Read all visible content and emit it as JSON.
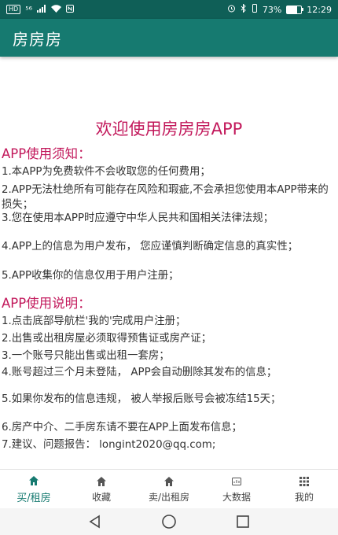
{
  "status_bar": {
    "left_badges": [
      "HD",
      "⁵⁶"
    ],
    "battery": "73%",
    "battery_level": 0.73,
    "time": "12:29"
  },
  "app_bar": {
    "title": "房房房"
  },
  "content": {
    "welcome": "欢迎使用房房房APP",
    "notice_title": "APP使用须知：",
    "notice_items": [
      "1.本APP为免费软件不会收取您的任何费用；",
      "2.APP无法杜绝所有可能存在风险和瑕疵,不会承担您使用本APP带来的损失；",
      "3.您在使用本APP时应遵守中华人民共和国相关法律法规；",
      "4.APP上的信息为用户发布， 您应谨慎判断确定信息的真实性；",
      "5.APP收集你的信息仅用于用户注册；"
    ],
    "usage_title": "APP使用说明：",
    "usage_items": [
      "1.点击底部导航栏'我的'完成用户注册；",
      "2.出售或出租房屋必须取得预售证或房产证；",
      "3.一个账号只能出售或出租一套房；",
      "4.账号超过三个月未登陆， APP会自动删除其发布的信息；",
      "5.如果你发布的信息违规， 被人举报后账号会被冻结15天；",
      "6.房产中介、二手房东请不要在APP上面发布信息；",
      "7.建议、问题报告： longint2020@qq.com;"
    ]
  },
  "bottom_nav": [
    {
      "label": "买/租房",
      "icon": "home-icon",
      "active": true
    },
    {
      "label": "收藏",
      "icon": "home-icon",
      "active": false
    },
    {
      "label": "卖/出租房",
      "icon": "home-icon",
      "active": false
    },
    {
      "label": "大数据",
      "icon": "data-icon",
      "active": false
    },
    {
      "label": "我的",
      "icon": "grid-icon",
      "active": false
    }
  ],
  "colors": {
    "status_bar": "#0f5f57",
    "app_bar": "#167a70",
    "accent_text": "#c2185b",
    "nav_active": "#167a70"
  }
}
